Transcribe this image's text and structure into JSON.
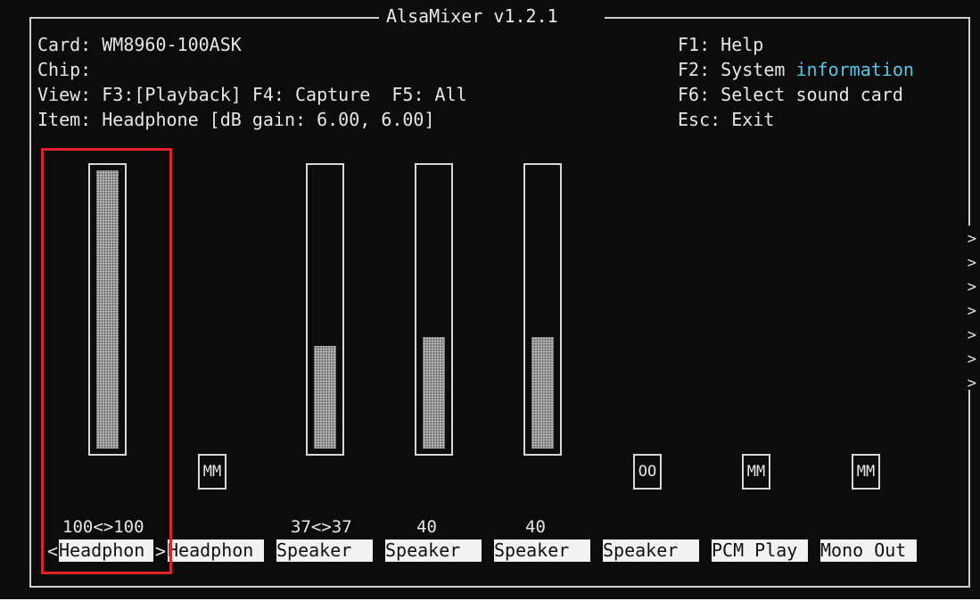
{
  "title": "AlsaMixer v1.2.1",
  "info": {
    "card": "Card: WM8960-100ASK",
    "chip": "Chip:",
    "view_prefix": "View: F3:",
    "view_active": "[Playback]",
    "view_rest": " F4: Capture  F5: All",
    "item": "Item: Headphone [dB gain: 6.00, 6.00]"
  },
  "keys": [
    {
      "key": "F1:",
      "label": "Help"
    },
    {
      "key": "F2:",
      "label": "System ",
      "label_highlight": "information"
    },
    {
      "key": "F6:",
      "label": "Select sound card"
    },
    {
      "key": "Esc:",
      "label": "Exit"
    }
  ],
  "controls": [
    {
      "name": "Headphon",
      "value_text": "100<>100",
      "volume": 1.0,
      "selected": true,
      "left_marker": "<",
      "right_marker": ">"
    },
    {
      "name": "Headphon",
      "switch": "MM"
    },
    {
      "name": "Speaker",
      "value_text": "37<>37",
      "volume": 0.37
    },
    {
      "name": "Speaker",
      "value_text": "40",
      "volume": 0.4
    },
    {
      "name": "Speaker",
      "value_text": "40",
      "volume": 0.4
    },
    {
      "name": "Speaker",
      "switch": "OO"
    },
    {
      "name": "PCM Play",
      "switch": "MM"
    },
    {
      "name": "Mono Out",
      "switch": "MM"
    }
  ],
  "more_indicator": [
    ">",
    ">",
    ">",
    ">",
    ">",
    ">",
    ">"
  ],
  "colors": {
    "background": "#0c0c0c",
    "text": "#e6e6e6",
    "info_highlight": "#52c7e8",
    "selection_box": "#e4202a",
    "label_bg": "#f2f2f2"
  }
}
